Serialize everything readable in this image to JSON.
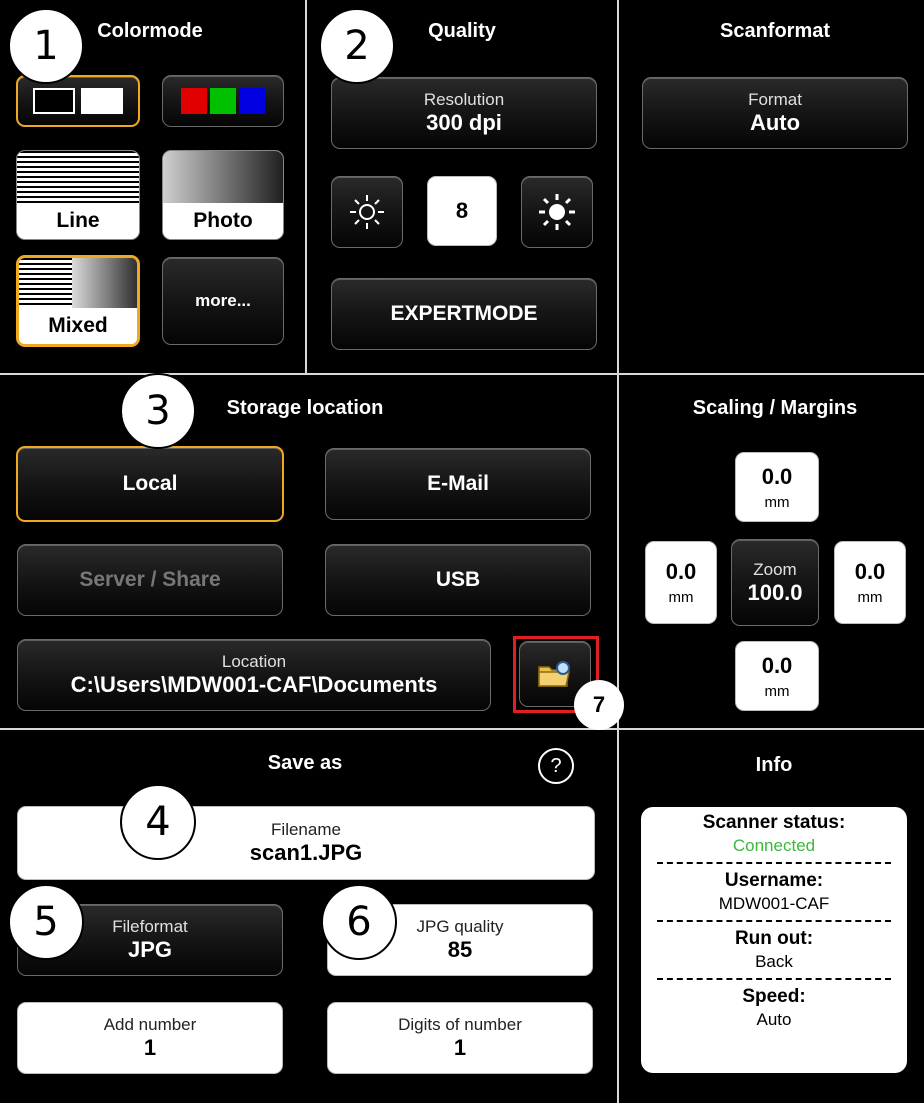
{
  "colormode": {
    "title": "Colormode",
    "modes": [
      {
        "label": "Line"
      },
      {
        "label": "Photo"
      },
      {
        "label": "Mixed"
      },
      {
        "label": "more..."
      }
    ]
  },
  "quality": {
    "title": "Quality",
    "resolution_label": "Resolution",
    "resolution_value": "300 dpi",
    "brightness_value": "8",
    "expert_label": "EXPERTMODE"
  },
  "scanformat": {
    "title": "Scanformat",
    "format_label": "Format",
    "format_value": "Auto"
  },
  "storage": {
    "title": "Storage location",
    "local": "Local",
    "email": "E-Mail",
    "server": "Server / Share",
    "usb": "USB",
    "location_label": "Location",
    "location_value": "C:\\Users\\MDW001-CAF\\Documents"
  },
  "scaling": {
    "title": "Scaling / Margins",
    "top_value": "0.0",
    "left_value": "0.0",
    "right_value": "0.0",
    "bottom_value": "0.0",
    "unit": "mm",
    "zoom_label": "Zoom",
    "zoom_value": "100.0"
  },
  "save_as": {
    "title": "Save as",
    "help": "?",
    "filename_label": "Filename",
    "filename_value": "scan1.JPG",
    "fileformat_label": "Fileformat",
    "fileformat_value": "JPG",
    "jpg_quality_label": "JPG quality",
    "jpg_quality_value": "85",
    "add_number_label": "Add number",
    "add_number_value": "1",
    "digits_label": "Digits of number",
    "digits_value": "1"
  },
  "info": {
    "title": "Info",
    "scanner_status_label": "Scanner status:",
    "scanner_status_value": "Connected",
    "username_label": "Username:",
    "username_value": "MDW001-CAF",
    "run_out_label": "Run out:",
    "run_out_value": "Back",
    "speed_label": "Speed:",
    "speed_value": "Auto"
  },
  "callouts": [
    "1",
    "2",
    "3",
    "4",
    "5",
    "6",
    "7"
  ],
  "colors": {
    "accent": "#f0a820",
    "connected": "#3cb83c",
    "highlight_box": "#e02020"
  }
}
